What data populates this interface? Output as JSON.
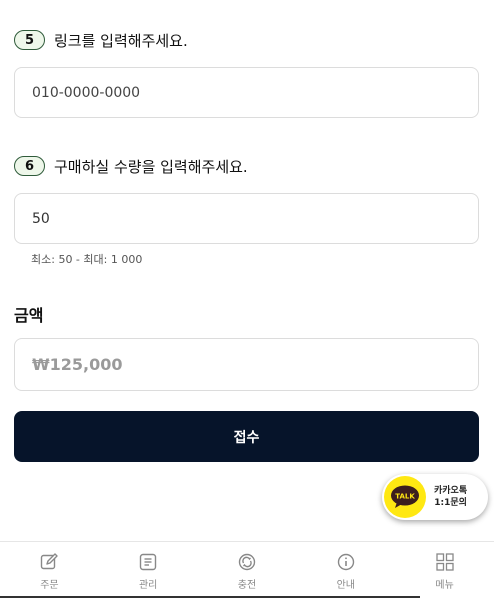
{
  "steps": [
    {
      "number": "5",
      "label": "링크를 입력해주세요.",
      "input_placeholder": "010-0000-0000",
      "input_value": ""
    },
    {
      "number": "6",
      "label": "구매하실 수량을 입력해주세요.",
      "input_placeholder": "",
      "input_value": "50"
    }
  ],
  "quantity_hint": "최소: 50 - 최대: 1 000",
  "amount": {
    "title": "금액",
    "value": "₩125,000"
  },
  "submit_label": "접수",
  "kakao": {
    "icon_text": "TALK",
    "line1": "카카오톡",
    "line2": "1:1문의"
  },
  "nav": [
    {
      "label": "주문",
      "icon": "edit-icon"
    },
    {
      "label": "관리",
      "icon": "list-icon"
    },
    {
      "label": "충전",
      "icon": "recharge-icon"
    },
    {
      "label": "안내",
      "icon": "info-icon"
    },
    {
      "label": "메뉴",
      "icon": "grid-icon"
    }
  ],
  "colors": {
    "primary": "#06142a",
    "badge_border": "#2f5b3a",
    "badge_bg": "#eef7ea",
    "kakao_yellow": "#ffe812"
  }
}
